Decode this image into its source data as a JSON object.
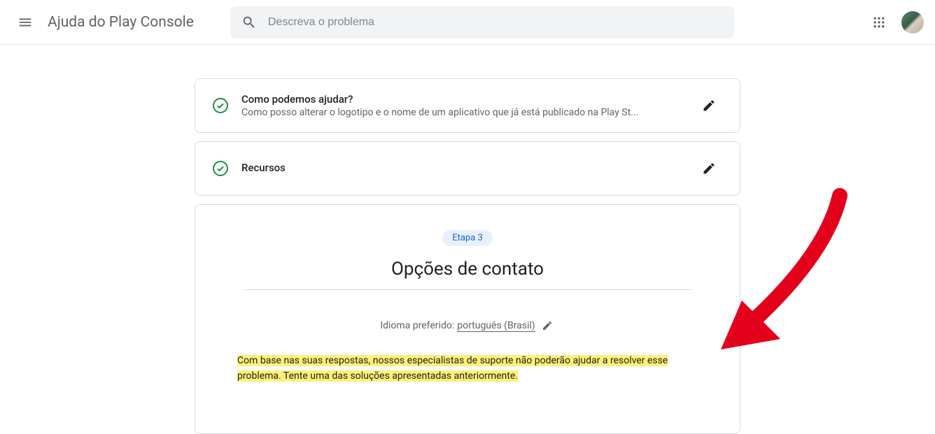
{
  "header": {
    "app_title": "Ajuda do Play Console",
    "search_placeholder": "Descreva o problema"
  },
  "steps": {
    "step1": {
      "title": "Como podemos ajudar?",
      "subtitle": "Como posso alterar o logotipo e o nome de um aplicativo que já está publicado na Play St..."
    },
    "step2": {
      "title": "Recursos"
    },
    "step3": {
      "chip": "Etapa 3",
      "heading": "Opções de contato",
      "lang_label": "Idioma preferido: ",
      "lang_value": "português (Brasil)",
      "message": "Com base nas suas respostas, nossos especialistas de suporte não poderão ajudar a resolver esse problema. Tente uma das soluções apresentadas anteriormente."
    }
  }
}
